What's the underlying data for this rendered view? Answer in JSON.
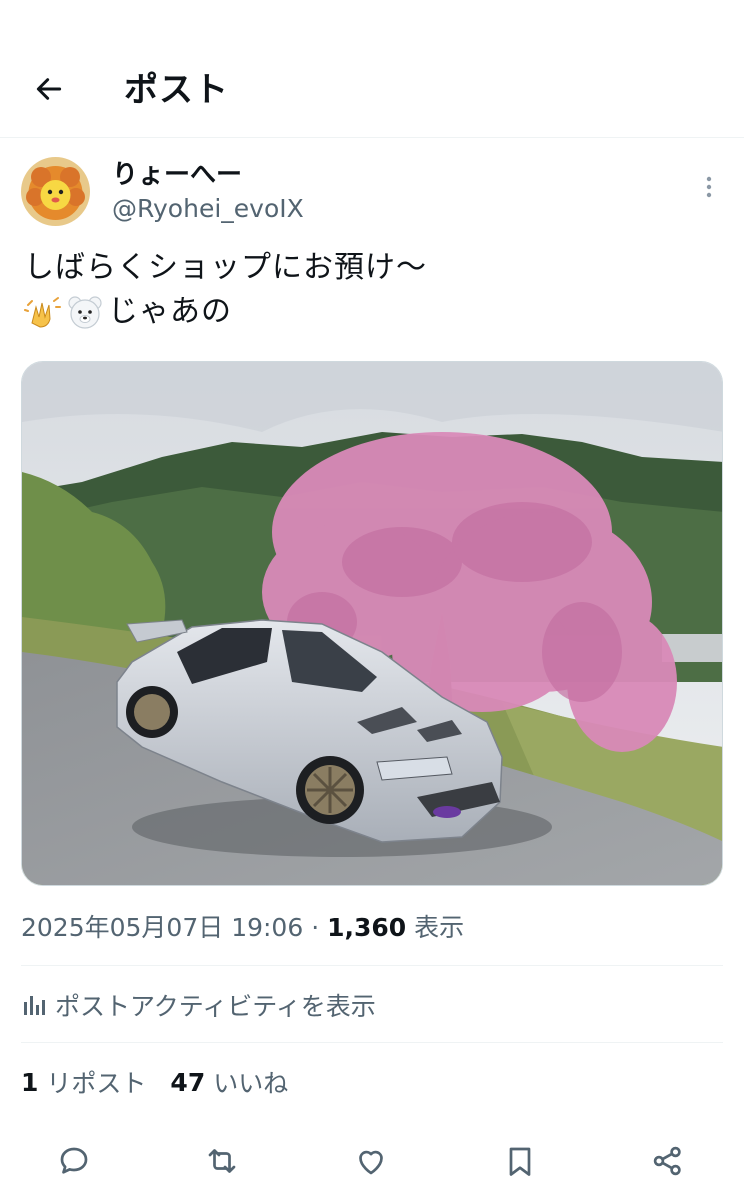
{
  "header": {
    "title": "ポスト",
    "back_icon": "arrow-left-icon"
  },
  "post": {
    "author": {
      "display_name": "りょーへー",
      "handle": "@Ryohei_evoIX"
    },
    "text_line1": "しばらくショップにお預け〜",
    "text_line2": "じゃあの",
    "emojis": [
      "waving-hands-emoji",
      "polar-bear-emoji"
    ],
    "image": {
      "alt": "Silver sedan parked by a roadside under a pink weeping cherry tree with forested mountains behind"
    },
    "timestamp": "2025年05月07日 19:06",
    "separator": "·",
    "views_count": "1,360",
    "views_label": "表示"
  },
  "activity": {
    "label": "ポストアクティビティを表示",
    "icon": "bar-chart-icon"
  },
  "stats": {
    "reposts_count": "1",
    "reposts_label": "リポスト",
    "likes_count": "47",
    "likes_label": "いいね"
  },
  "actions": [
    "reply-icon",
    "repost-icon",
    "like-icon",
    "bookmark-icon",
    "share-icon"
  ],
  "colors": {
    "text": "#0f1419",
    "secondary": "#536471",
    "divider": "#eff3f4"
  }
}
